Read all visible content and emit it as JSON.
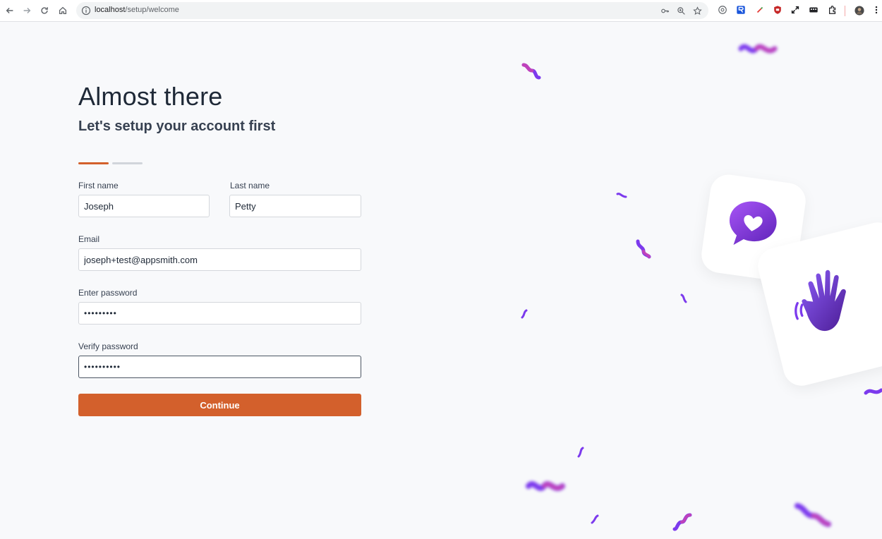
{
  "browser": {
    "url_host": "localhost",
    "url_path": "/setup/welcome"
  },
  "setup": {
    "title": "Almost there",
    "subtitle": "Let's setup your account first",
    "steps": {
      "total": 2,
      "current": 1
    },
    "fields": {
      "first_name": {
        "label": "First name",
        "value": "Joseph"
      },
      "last_name": {
        "label": "Last name",
        "value": "Petty"
      },
      "email": {
        "label": "Email",
        "value": "joseph+test@appsmith.com"
      },
      "password": {
        "label": "Enter password",
        "value": "•••••••••"
      },
      "verify_password": {
        "label": "Verify password",
        "value": "••••••••••"
      }
    },
    "continue_label": "Continue"
  },
  "colors": {
    "accent": "#d3602c",
    "confetti_purple": "#7c3aed",
    "confetti_pink": "#ec4899"
  },
  "illustration": {
    "icons": [
      "chat-heart-icon",
      "waving-hand-icon"
    ]
  }
}
